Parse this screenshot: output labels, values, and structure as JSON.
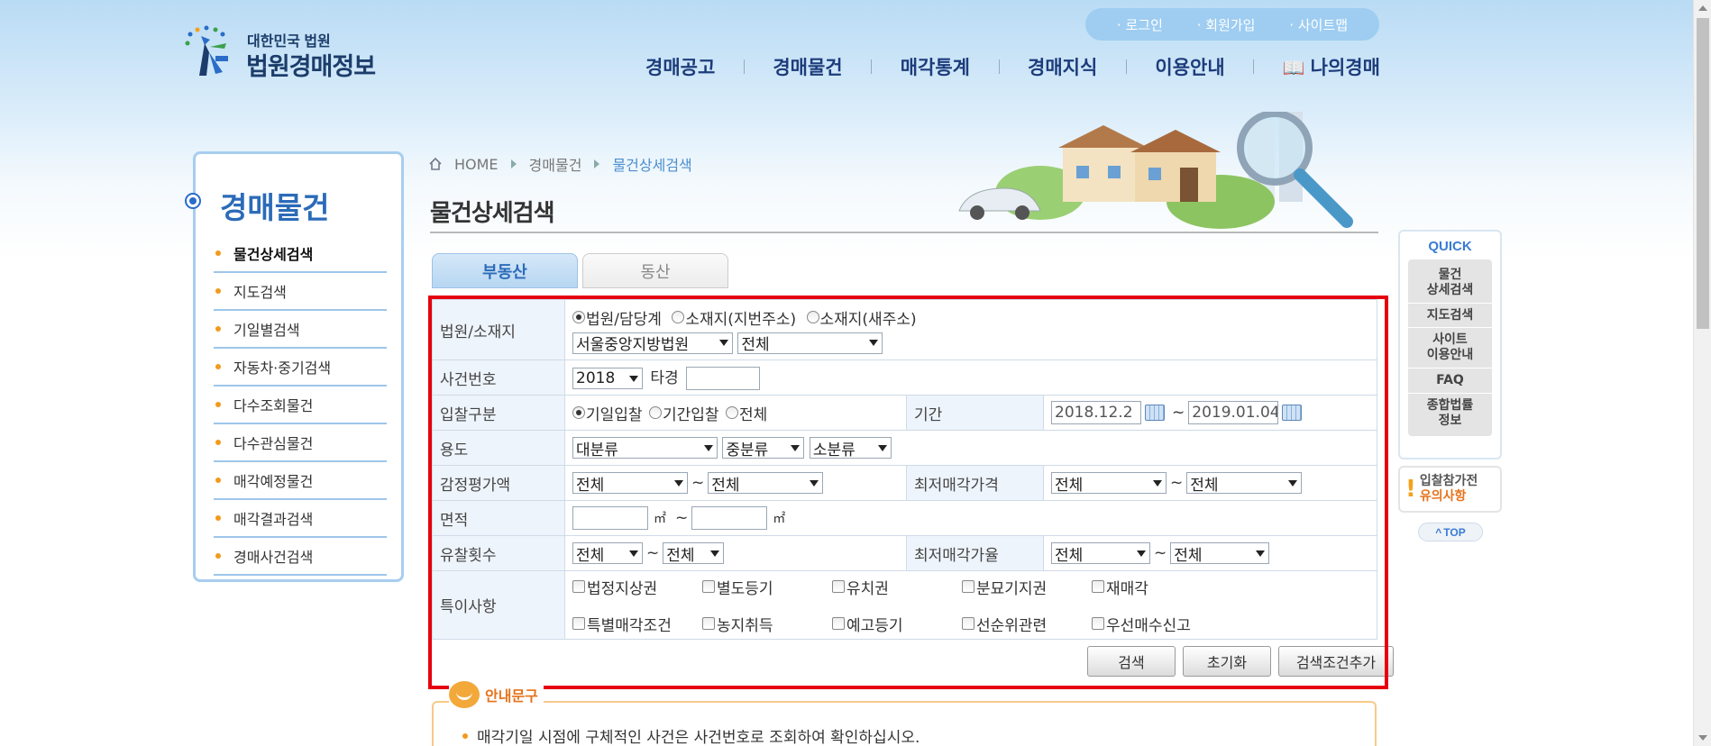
{
  "logo": {
    "small": "대한민국 법원",
    "big": "법원경매정보"
  },
  "util_links": [
    "로그인",
    "회원가입",
    "사이트맵"
  ],
  "gnb": [
    "경매공고",
    "경매물건",
    "매각통계",
    "경매지식",
    "이용안내",
    "나의경매"
  ],
  "lnb": {
    "title": "경매물건",
    "items": [
      "물건상세검색",
      "지도검색",
      "기일별검색",
      "자동차·중기검색",
      "다수조회물건",
      "다수관심물건",
      "매각예정물건",
      "매각결과검색",
      "경매사건검색"
    ]
  },
  "breadcrumb": {
    "home": "HOME",
    "level1": "경매물건",
    "current": "물건상세검색"
  },
  "page_title": "물건상세검색",
  "tabs": {
    "active": "부동산",
    "inactive": "동산"
  },
  "form": {
    "court_label": "법원/소재지",
    "court_radios": [
      "법원/담당계",
      "소재지(지번주소)",
      "소재지(새주소)"
    ],
    "court_select": "서울중앙지방법원",
    "dept_select": "전체",
    "case_label": "사건번호",
    "case_year": "2018",
    "case_type": "타경",
    "bid_label": "입찰구분",
    "bid_radios": [
      "기일입찰",
      "기간입찰",
      "전체"
    ],
    "period_label": "기간",
    "period_from": "2018.12.2",
    "period_to": "2019.01.04",
    "usage_label": "용도",
    "usage_selects": [
      "대분류",
      "중분류",
      "소분류"
    ],
    "appraisal_label": "감정평가액",
    "appraisal_from": "전체",
    "appraisal_to": "전체",
    "minprice_label": "최저매각가격",
    "minprice_from": "전체",
    "minprice_to": "전체",
    "area_label": "면적",
    "area_unit": "㎡",
    "fail_label": "유찰횟수",
    "fail_from": "전체",
    "fail_to": "전체",
    "minrate_label": "최저매각가율",
    "minrate_from": "전체",
    "minrate_to": "전체",
    "special_label": "특이사항",
    "special_checks": [
      "법정지상권",
      "별도등기",
      "유치권",
      "분묘기지권",
      "재매각",
      "특별매각조건",
      "농지취득",
      "예고등기",
      "선순위관련",
      "우선매수신고"
    ],
    "tilde": "~"
  },
  "buttons": {
    "search": "검색",
    "reset": "초기화",
    "add": "검색조건추가"
  },
  "notice": {
    "badge": "안내문구",
    "line": "매각기일 시점에 구체적인 사건은 사건번호로 조회하여 확인하십시오."
  },
  "quick": {
    "title": "QUICK",
    "items": [
      "물건\n상세검색",
      "지도검색",
      "사이트\n이용안내",
      "FAQ",
      "종합법률\n정보"
    ]
  },
  "warn": {
    "line1": "입찰참가전",
    "line2": "유의사항"
  },
  "top_button": "TOP",
  "colors": {
    "accent": "#2b6bb8",
    "highlight_border": "#e6000f",
    "orange": "#f29a1b"
  }
}
